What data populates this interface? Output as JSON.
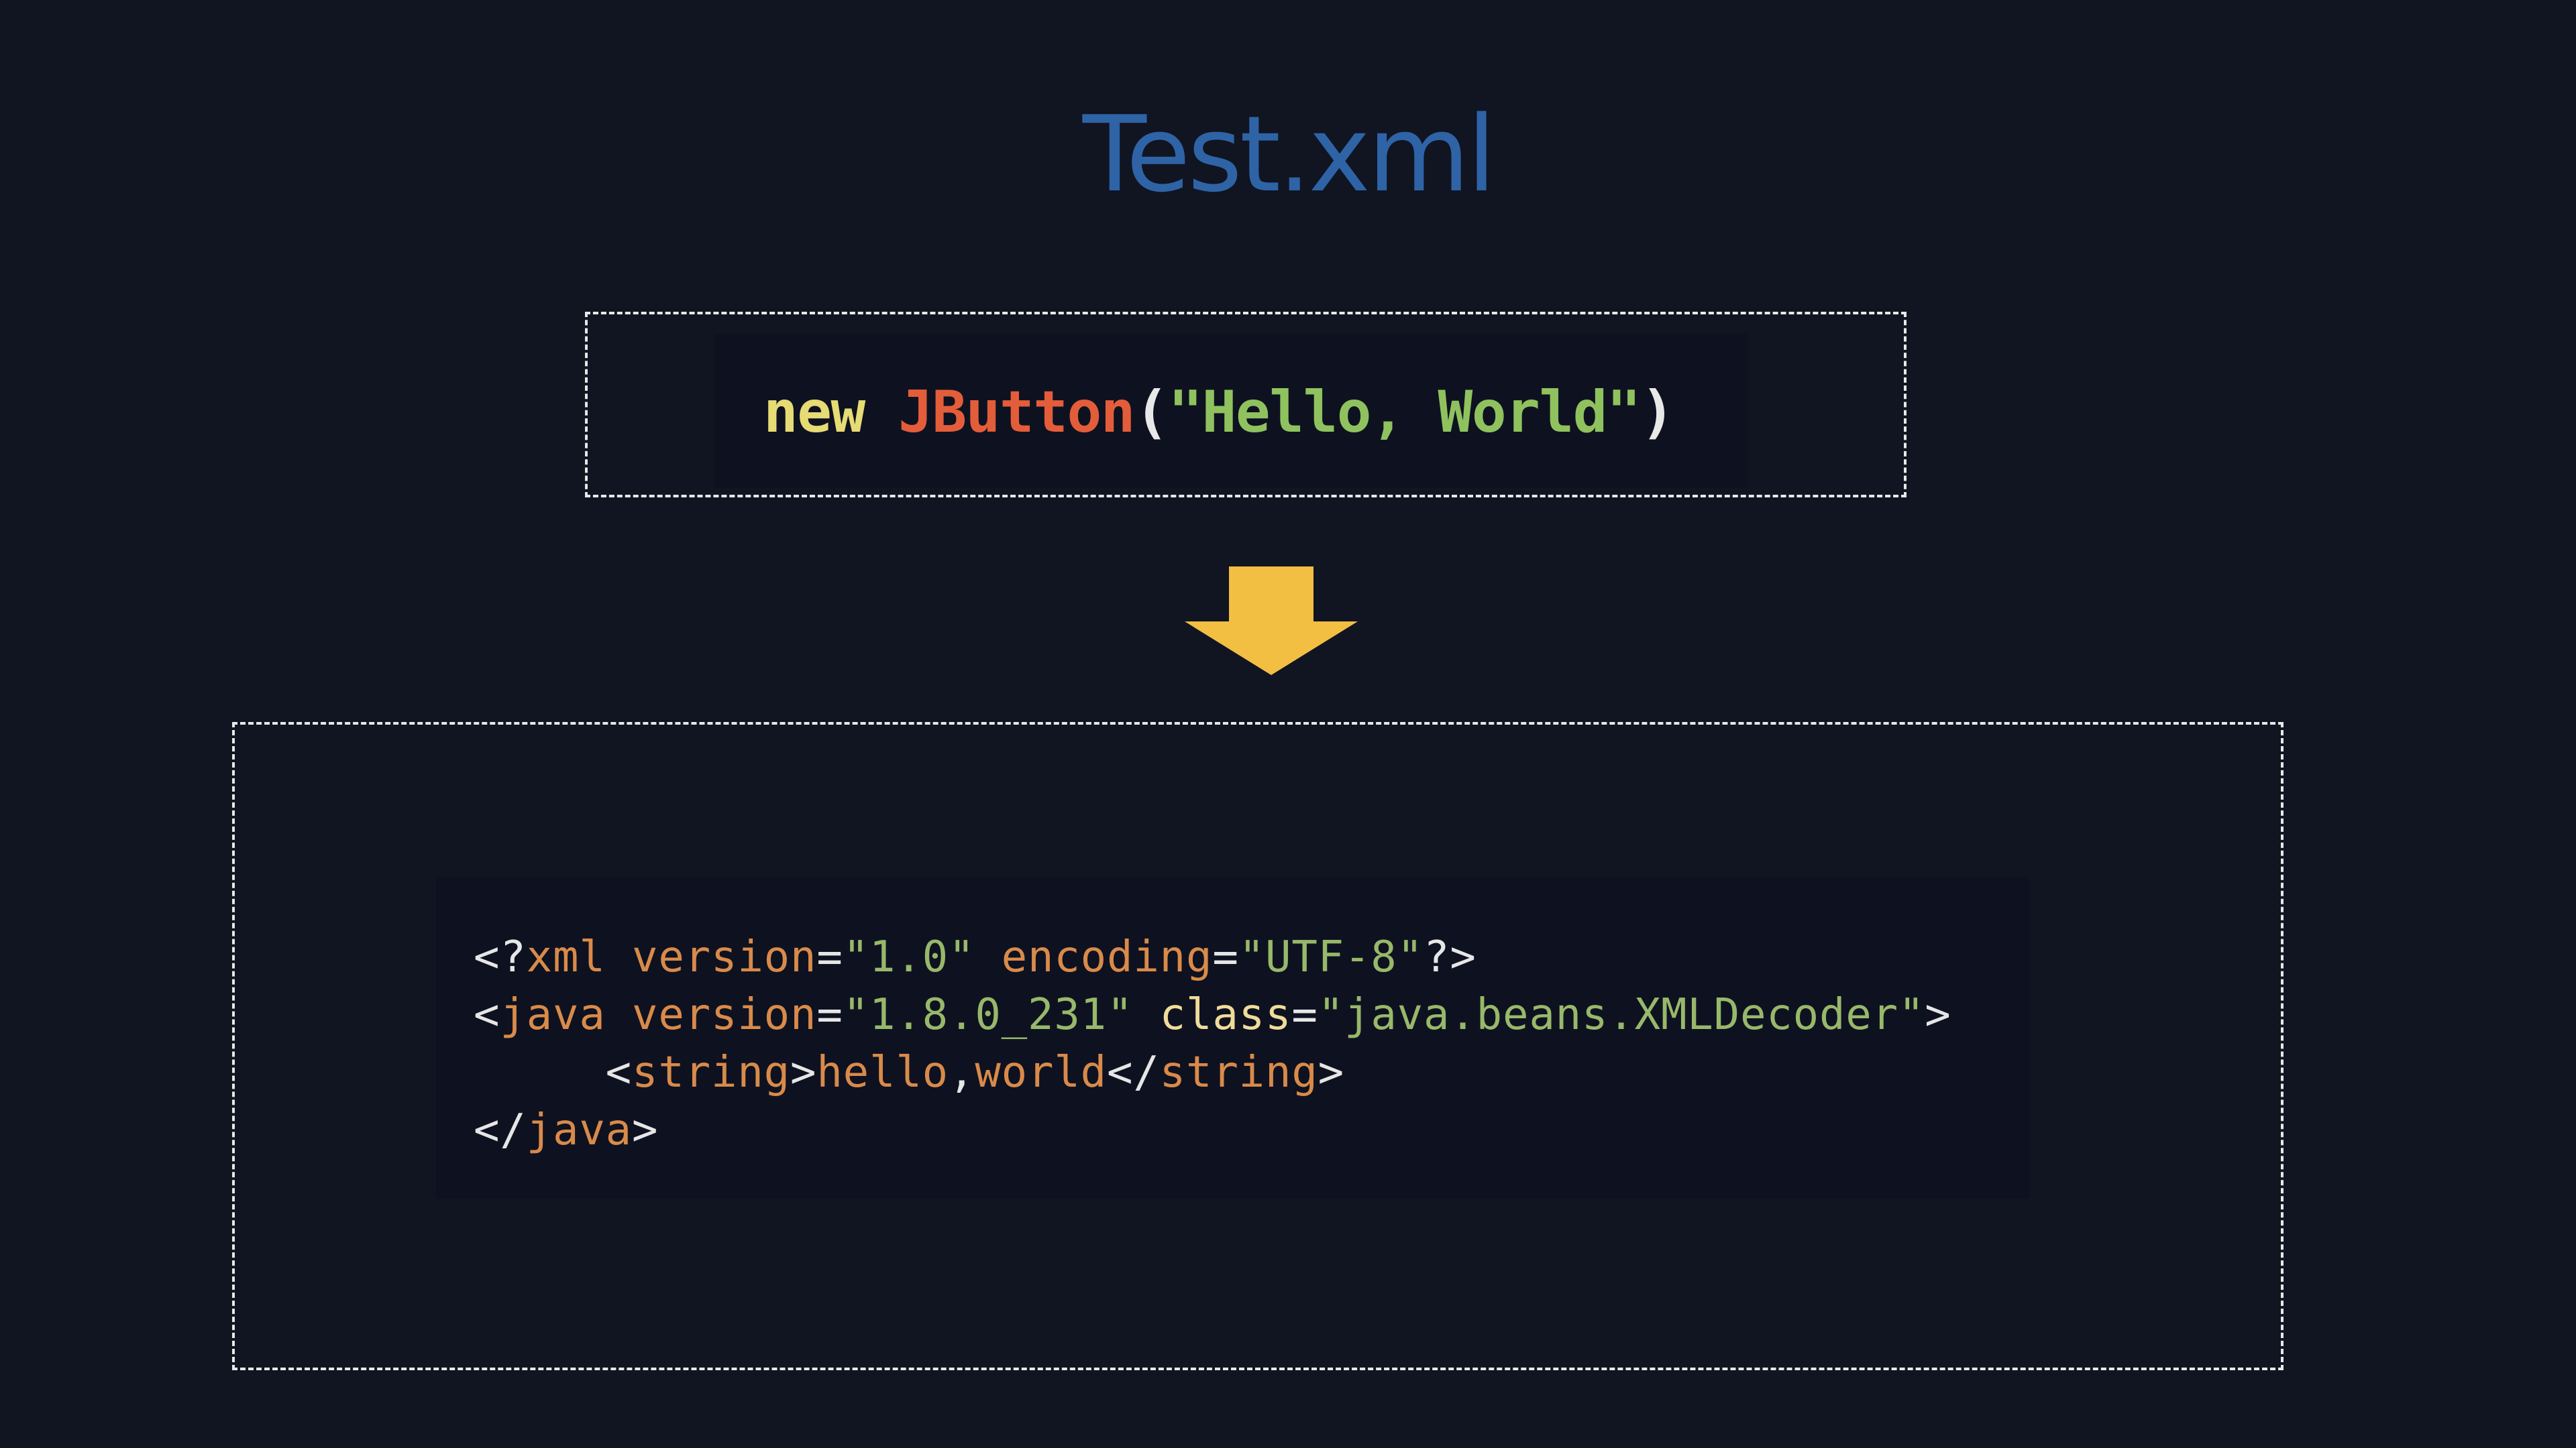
{
  "title": "Test.xml",
  "java_snippet": {
    "keyword": "new",
    "class_name": "JButton",
    "open_paren": "(",
    "string_literal": "\"Hello, World\"",
    "close_paren": ")"
  },
  "arrow": {
    "icon": "down-arrow-icon",
    "color": "#f2bf42"
  },
  "xml_snippet": {
    "line1": {
      "open": "<?",
      "tag": "xml",
      "attr1": " version",
      "eq1": "=",
      "val1": "\"1.0\"",
      "attr2": " encoding",
      "eq2": "=",
      "val2": "\"UTF-8\"",
      "close": "?>"
    },
    "line2": {
      "open": "<",
      "tag": "java",
      "attr1": " version",
      "eq1": "=",
      "val1": "\"1.8.0_231\"",
      "attr2": " class",
      "eq2": "=",
      "val2": "\"java.beans.XMLDecoder\"",
      "close": ">"
    },
    "line3": {
      "indent": "     ",
      "open": "<",
      "tag": "string",
      "gt": ">",
      "text1": "hello",
      "comma": ",",
      "text2": "world",
      "close_open": "</",
      "close_tag": "string",
      "close": ">"
    },
    "line4": {
      "open": "</",
      "tag": "java",
      "close": ">"
    }
  }
}
